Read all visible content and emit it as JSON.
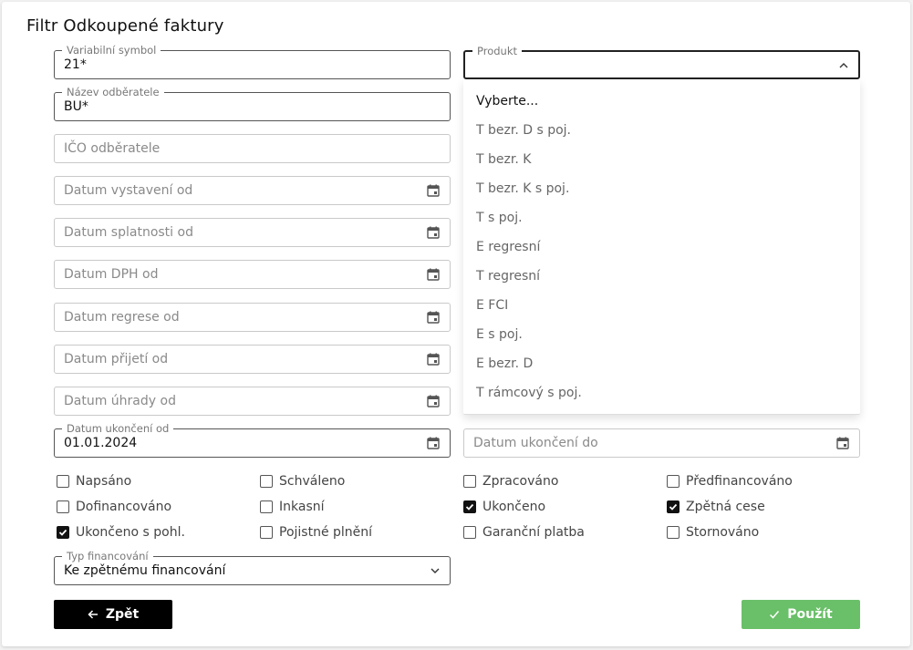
{
  "title": "Filtr Odkoupené faktury",
  "fields": {
    "variabilni_symbol": {
      "label": "Variabilní symbol",
      "value": "21*"
    },
    "produkt": {
      "label": "Produkt",
      "value": ""
    },
    "nazev_odberatele": {
      "label": "Název odběratele",
      "value": "BU*"
    },
    "ico_odberatele": {
      "placeholder": "IČO odběratele"
    },
    "datum_vystaveni_od": {
      "placeholder": "Datum vystavení od"
    },
    "datum_splatnosti_od": {
      "placeholder": "Datum splatnosti od"
    },
    "datum_dph_od": {
      "placeholder": "Datum DPH od"
    },
    "datum_regrese_od": {
      "placeholder": "Datum regrese od"
    },
    "datum_prijeti_od": {
      "placeholder": "Datum přijetí od"
    },
    "datum_uhrady_od": {
      "placeholder": "Datum úhrady od"
    },
    "datum_ukonceni_od": {
      "label": "Datum ukončení od",
      "value": "01.01.2024"
    },
    "datum_ukonceni_do": {
      "placeholder": "Datum ukončení do"
    },
    "typ_financovani": {
      "label": "Typ financování",
      "value": "Ke zpětnému financování"
    }
  },
  "produkt_options": [
    "Vyberte...",
    "T bezr. D s poj.",
    "T bezr. K",
    "T bezr. K s poj.",
    "T s poj.",
    "E regresní",
    "T regresní",
    "E FCI",
    "E s poj.",
    "E bezr. D",
    "T rámcový s poj."
  ],
  "checkboxes": [
    {
      "label": "Napsáno",
      "checked": false
    },
    {
      "label": "Schváleno",
      "checked": false
    },
    {
      "label": "Zpracováno",
      "checked": false
    },
    {
      "label": "Předfinancováno",
      "checked": false
    },
    {
      "label": "Dofinancováno",
      "checked": false
    },
    {
      "label": "Inkasní",
      "checked": false
    },
    {
      "label": "Ukončeno",
      "checked": true
    },
    {
      "label": "Zpětná cese",
      "checked": true
    },
    {
      "label": "Ukončeno s pohl.",
      "checked": true
    },
    {
      "label": "Pojistné plnění",
      "checked": false
    },
    {
      "label": "Garanční platba",
      "checked": false
    },
    {
      "label": "Stornováno",
      "checked": false
    }
  ],
  "buttons": {
    "back": "Zpět",
    "apply": "Použít"
  },
  "colors": {
    "apply_bg": "#6abf69",
    "back_bg": "#000000"
  },
  "icons": {
    "date": "calendar-icon",
    "select": "chevron-icon",
    "back": "arrow-left-icon",
    "apply": "check-icon"
  }
}
